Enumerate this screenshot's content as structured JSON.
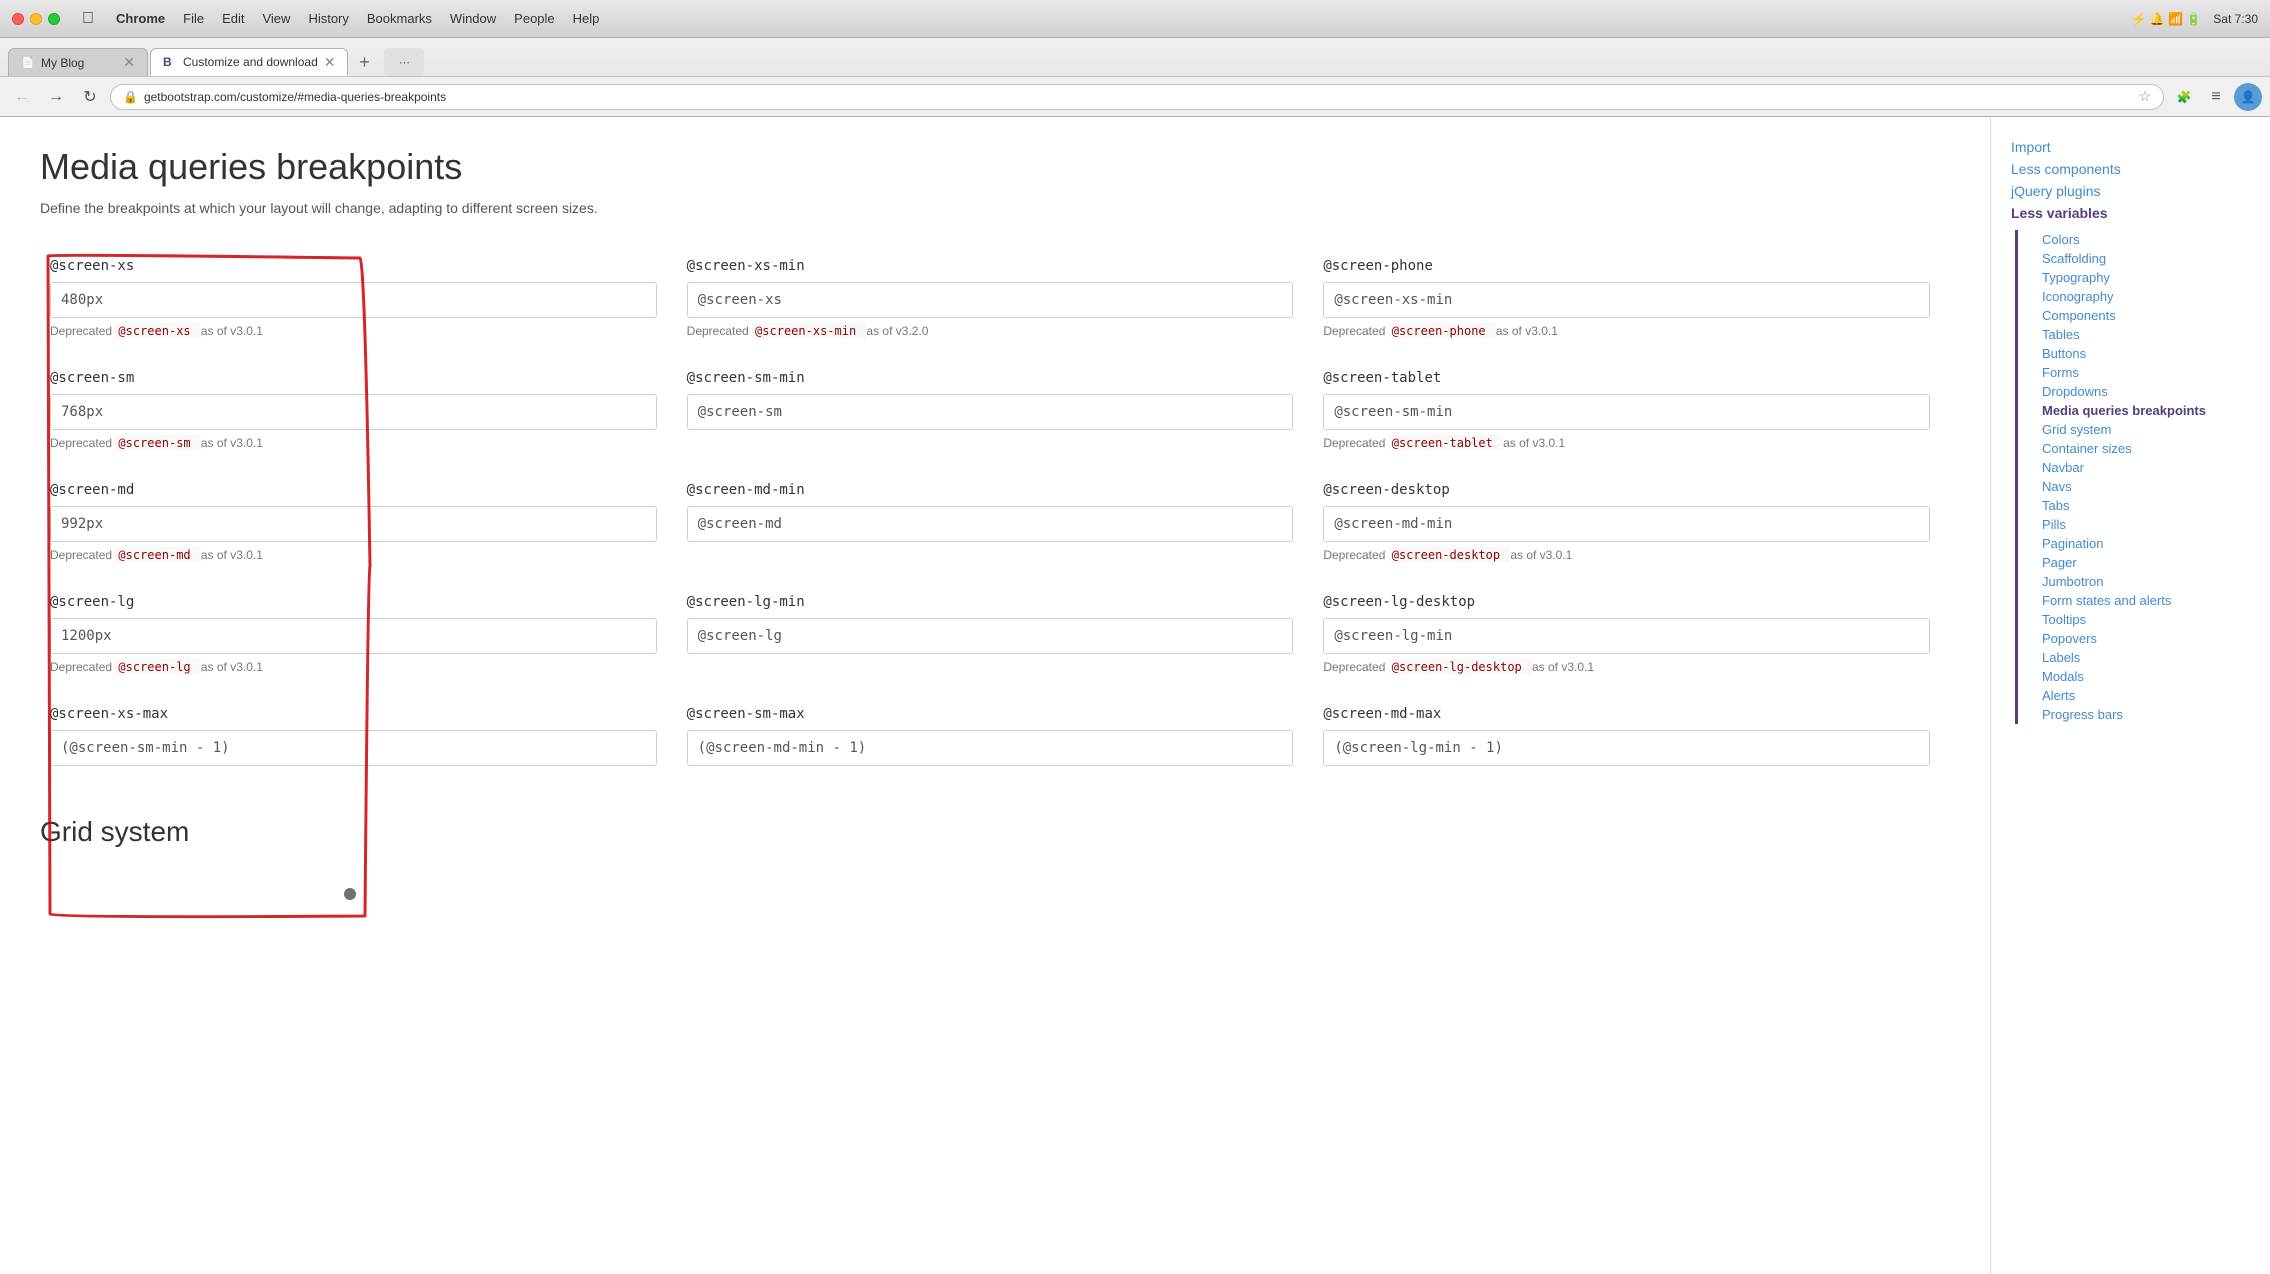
{
  "menubar": {
    "apple": "🍎",
    "items": [
      "Chrome",
      "File",
      "Edit",
      "View",
      "History",
      "Bookmarks",
      "Window",
      "People",
      "Help"
    ],
    "chrome_bold": "Chrome"
  },
  "tabs": [
    {
      "id": "tab1",
      "title": "My Blog",
      "favicon": "📄",
      "active": false
    },
    {
      "id": "tab2",
      "title": "Customize and download",
      "favicon": "B",
      "active": true
    }
  ],
  "address_bar": {
    "url": "getbootstrap.com/customize/#media-queries-breakpoints"
  },
  "page": {
    "title": "Media queries breakpoints",
    "description": "Define the breakpoints at which your layout will change, adapting to different screen sizes.",
    "bottom_section": "Grid system"
  },
  "breakpoints": [
    {
      "col": 0,
      "label": "@screen-xs",
      "value": "480px",
      "deprecated_var": "@screen-xs",
      "deprecated_since": "as of v3.0.1"
    },
    {
      "col": 1,
      "label": "@screen-xs-min",
      "value": "@screen-xs",
      "deprecated_var": "@screen-xs-min",
      "deprecated_since": "as of v3.2.0"
    },
    {
      "col": 2,
      "label": "@screen-phone",
      "value": "@screen-xs-min",
      "deprecated_var": "@screen-phone",
      "deprecated_since": "as of v3.0.1"
    },
    {
      "col": 0,
      "label": "@screen-sm",
      "value": "768px",
      "deprecated_var": "@screen-sm",
      "deprecated_since": "as of v3.0.1"
    },
    {
      "col": 1,
      "label": "@screen-sm-min",
      "value": "@screen-sm",
      "deprecated_var": null
    },
    {
      "col": 2,
      "label": "@screen-tablet",
      "value": "@screen-sm-min",
      "deprecated_var": "@screen-tablet",
      "deprecated_since": "as of v3.0.1"
    },
    {
      "col": 0,
      "label": "@screen-md",
      "value": "992px",
      "deprecated_var": "@screen-md",
      "deprecated_since": "as of v3.0.1"
    },
    {
      "col": 1,
      "label": "@screen-md-min",
      "value": "@screen-md",
      "deprecated_var": null
    },
    {
      "col": 2,
      "label": "@screen-desktop",
      "value": "@screen-md-min",
      "deprecated_var": "@screen-desktop",
      "deprecated_since": "as of v3.0.1"
    },
    {
      "col": 0,
      "label": "@screen-lg",
      "value": "1200px",
      "deprecated_var": "@screen-lg",
      "deprecated_since": "as of v3.0.1"
    },
    {
      "col": 1,
      "label": "@screen-lg-min",
      "value": "@screen-lg",
      "deprecated_var": null
    },
    {
      "col": 2,
      "label": "@screen-lg-desktop",
      "value": "@screen-lg-min",
      "deprecated_var": "@screen-lg-desktop",
      "deprecated_since": "as of v3.0.1"
    },
    {
      "col": 0,
      "label": "@screen-xs-max",
      "value": "(@screen-sm-min - 1)",
      "deprecated_var": null
    },
    {
      "col": 1,
      "label": "@screen-sm-max",
      "value": "(@screen-md-min - 1)",
      "deprecated_var": null
    },
    {
      "col": 2,
      "label": "@screen-md-max",
      "value": "(@screen-lg-min - 1)",
      "deprecated_var": null
    }
  ],
  "sidebar": {
    "top_links": [
      {
        "label": "Import",
        "id": "import"
      },
      {
        "label": "Less components",
        "id": "less-components"
      },
      {
        "label": "jQuery plugins",
        "id": "jquery-plugins"
      },
      {
        "label": "Less variables",
        "id": "less-variables",
        "active": true
      }
    ],
    "sub_links": [
      {
        "label": "Colors",
        "id": "colors"
      },
      {
        "label": "Scaffolding",
        "id": "scaffolding"
      },
      {
        "label": "Typography",
        "id": "typography"
      },
      {
        "label": "Iconography",
        "id": "iconography"
      },
      {
        "label": "Components",
        "id": "components"
      },
      {
        "label": "Tables",
        "id": "tables"
      },
      {
        "label": "Buttons",
        "id": "buttons"
      },
      {
        "label": "Forms",
        "id": "forms"
      },
      {
        "label": "Dropdowns",
        "id": "dropdowns"
      },
      {
        "label": "Media queries breakpoints",
        "id": "media-queries-breakpoints",
        "active": true
      },
      {
        "label": "Grid system",
        "id": "grid-system"
      },
      {
        "label": "Container sizes",
        "id": "container-sizes"
      },
      {
        "label": "Navbar",
        "id": "navbar"
      },
      {
        "label": "Navs",
        "id": "navs"
      },
      {
        "label": "Tabs",
        "id": "tabs"
      },
      {
        "label": "Pills",
        "id": "pills"
      },
      {
        "label": "Pagination",
        "id": "pagination"
      },
      {
        "label": "Pager",
        "id": "pager"
      },
      {
        "label": "Jumbotron",
        "id": "jumbotron"
      },
      {
        "label": "Form states and alerts",
        "id": "form-states"
      },
      {
        "label": "Tooltips",
        "id": "tooltips"
      },
      {
        "label": "Popovers",
        "id": "popovers"
      },
      {
        "label": "Labels",
        "id": "labels"
      },
      {
        "label": "Modals",
        "id": "modals"
      },
      {
        "label": "Alerts",
        "id": "alerts"
      },
      {
        "label": "Progress bars",
        "id": "progress-bars"
      }
    ]
  },
  "deprecated_label": "Deprecated"
}
